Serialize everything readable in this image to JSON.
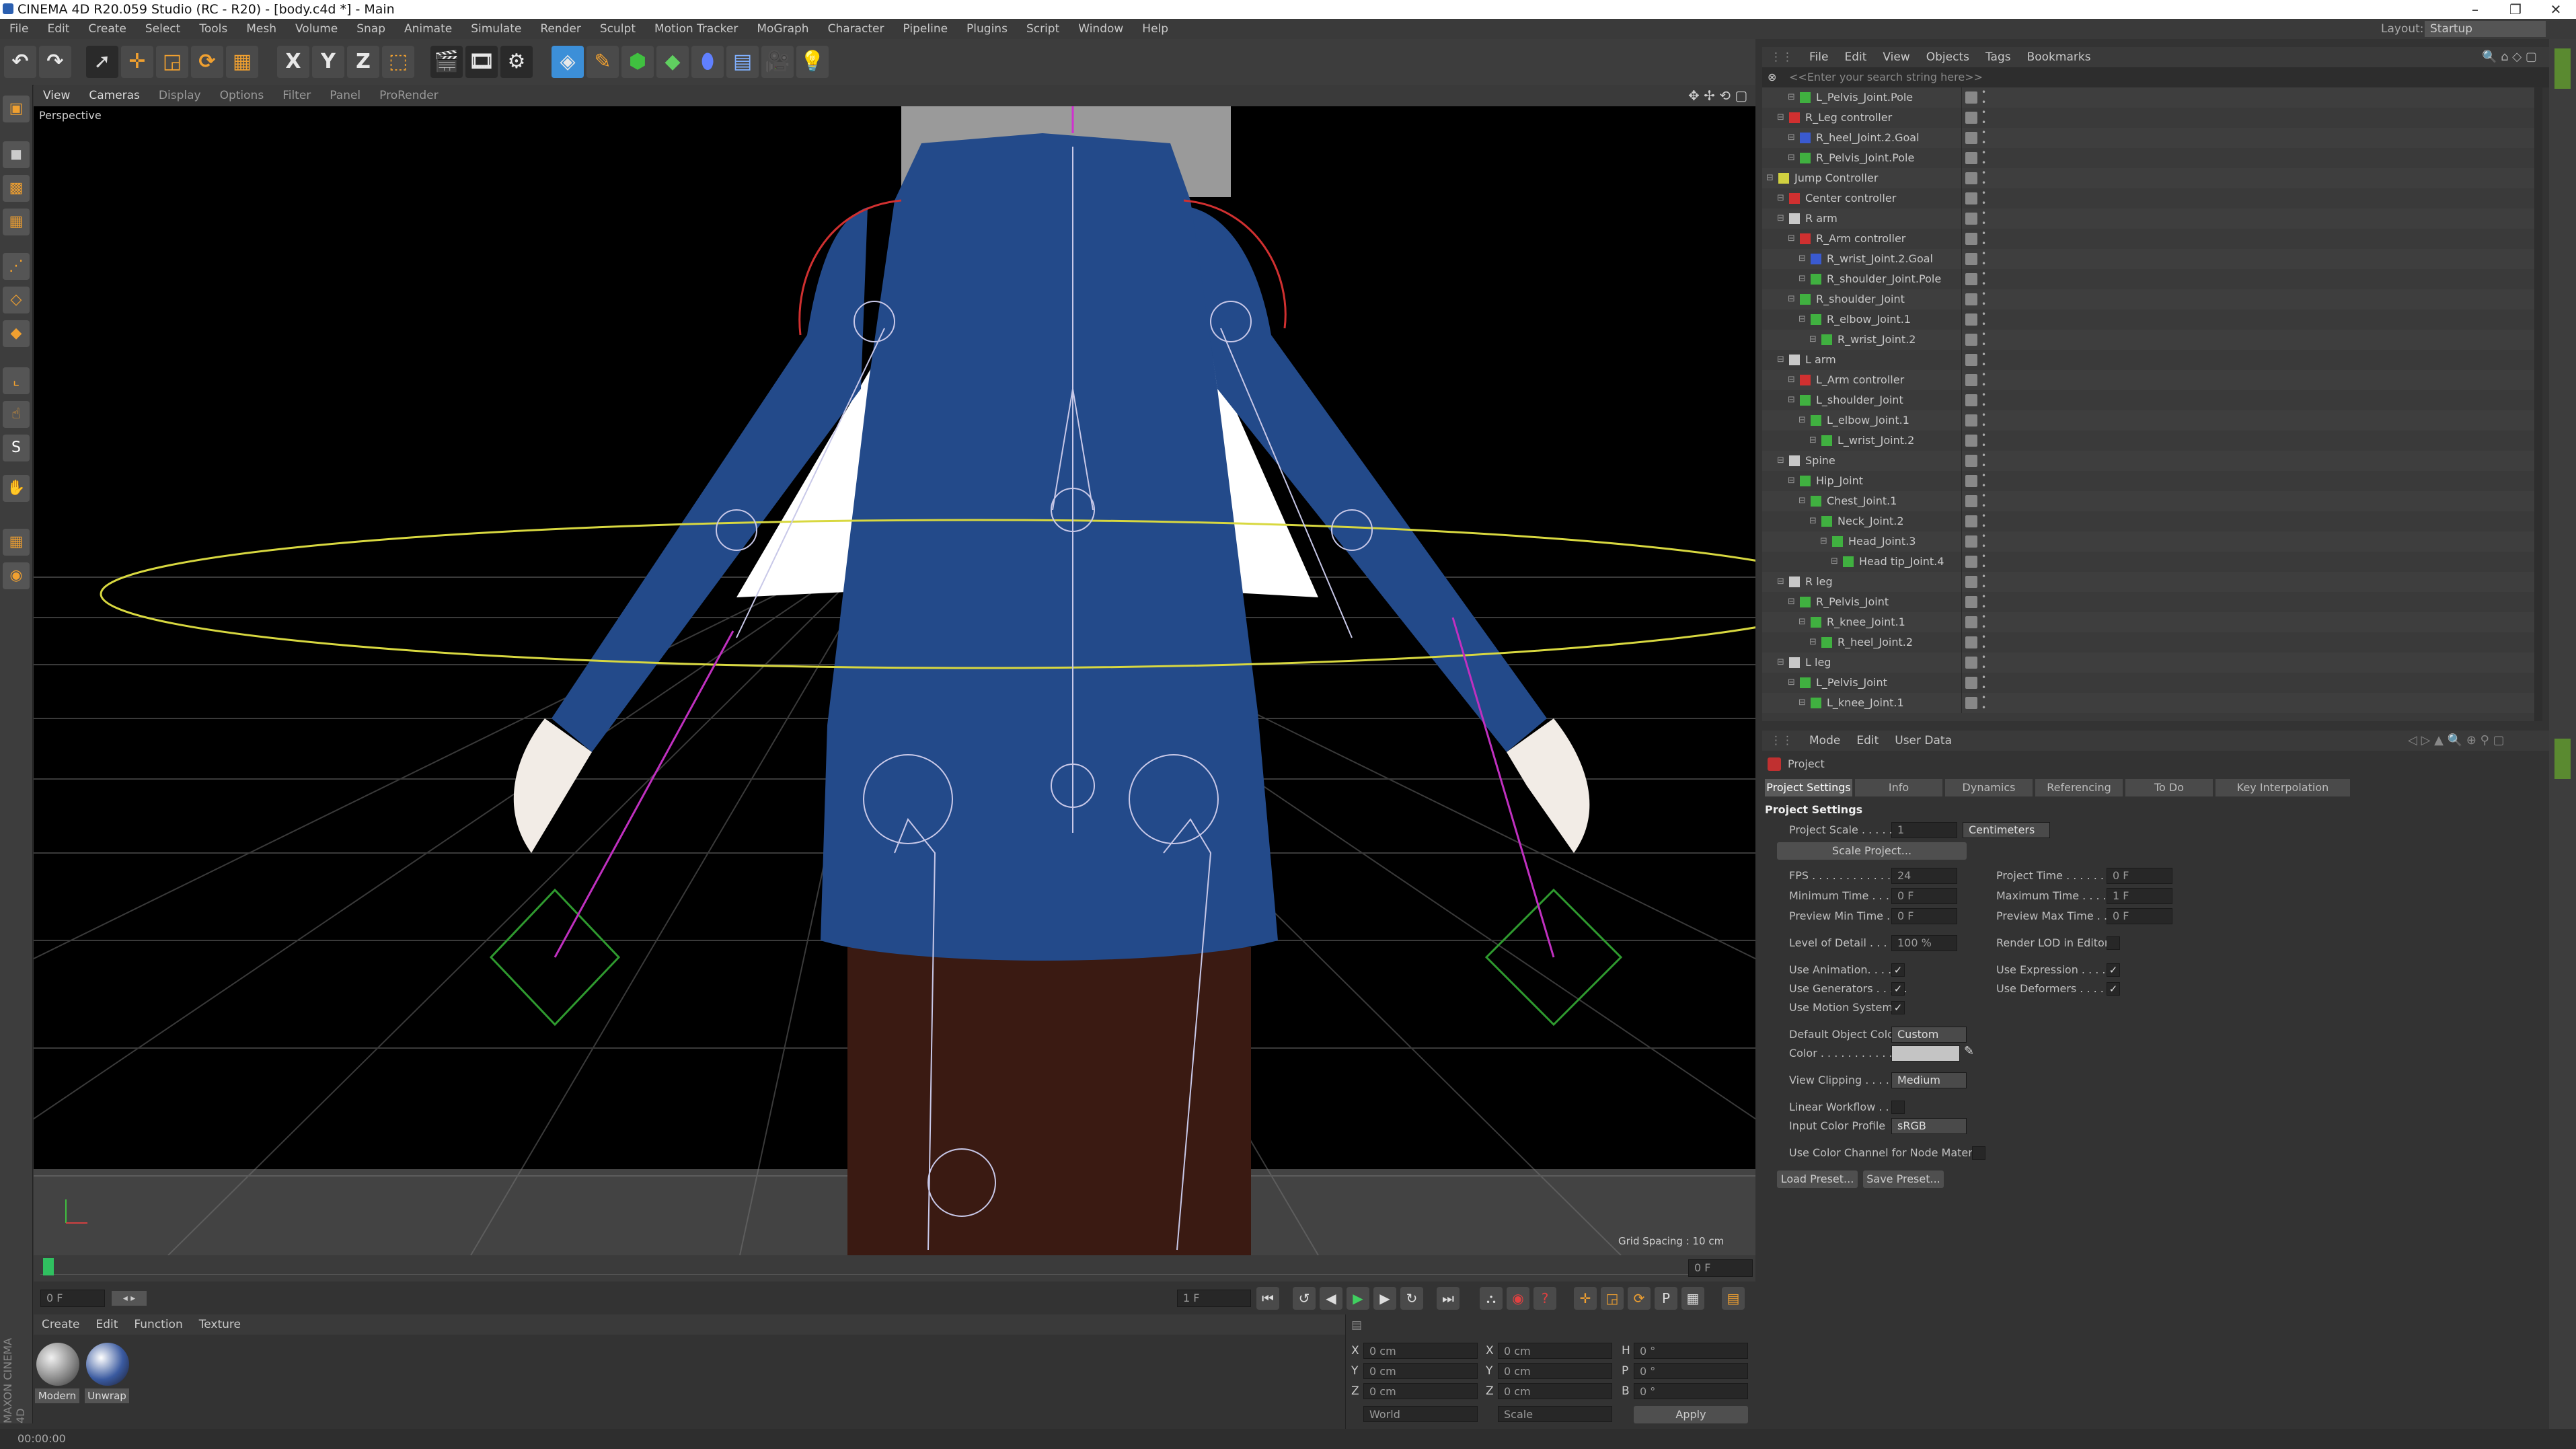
{
  "window": {
    "title": "CINEMA 4D R20.059 Studio (RC - R20) - [body.c4d *] - Main",
    "layout_label": "Layout:",
    "layout_value": "Startup"
  },
  "menu": [
    "File",
    "Edit",
    "Create",
    "Select",
    "Tools",
    "Mesh",
    "Volume",
    "Snap",
    "Animate",
    "Simulate",
    "Render",
    "Sculpt",
    "Motion Tracker",
    "MoGraph",
    "Character",
    "Pipeline",
    "Plugins",
    "Script",
    "Window",
    "Help"
  ],
  "toolbar": {
    "x": "X",
    "y": "Y",
    "z": "Z"
  },
  "viewport": {
    "menu": [
      "View",
      "Cameras",
      "Display",
      "Options",
      "Filter",
      "Panel",
      "ProRender"
    ],
    "camera": "Perspective",
    "grid_spacing": "Grid Spacing : 10 cm"
  },
  "timeline": {
    "current_frame": "0 F",
    "end_frame": "0 F",
    "range_start": "0 F",
    "range_end": "1 F"
  },
  "materials": {
    "menu": [
      "Create",
      "Edit",
      "Function",
      "Texture"
    ],
    "items": [
      {
        "name": "Modern",
        "color": "#bdbdbd"
      },
      {
        "name": "Unwrap",
        "color": "#d8d8d8"
      }
    ]
  },
  "coords": {
    "rows": [
      {
        "a": "X",
        "av": "0 cm",
        "b": "X",
        "bv": "0 cm",
        "c": "H",
        "cv": "0 °"
      },
      {
        "a": "Y",
        "av": "0 cm",
        "b": "Y",
        "bv": "0 cm",
        "c": "P",
        "cv": "0 °"
      },
      {
        "a": "Z",
        "av": "0 cm",
        "b": "Z",
        "bv": "0 cm",
        "c": "B",
        "cv": "0 °"
      }
    ],
    "mode": "World",
    "scale": "Scale",
    "apply": "Apply"
  },
  "status": {
    "time": "00:00:00"
  },
  "objects": {
    "menu": [
      "File",
      "Edit",
      "View",
      "Objects",
      "Tags",
      "Bookmarks"
    ],
    "search_placeholder": "<<Enter your search string here>>",
    "rows": [
      {
        "name": "L_Pelvis_Joint.Pole",
        "indent": 2,
        "icon": "#40b040"
      },
      {
        "name": "R_Leg controller",
        "indent": 1,
        "icon": "#d03030"
      },
      {
        "name": "R_heel_Joint.2.Goal",
        "indent": 2,
        "icon": "#3a5ad0"
      },
      {
        "name": "R_Pelvis_Joint.Pole",
        "indent": 2,
        "icon": "#40b040"
      },
      {
        "name": "Jump Controller",
        "indent": 0,
        "icon": "#d0d040"
      },
      {
        "name": "Center controller",
        "indent": 1,
        "icon": "#d03030"
      },
      {
        "name": "R arm",
        "indent": 1,
        "icon": "#c8c8c8"
      },
      {
        "name": "R_Arm controller",
        "indent": 2,
        "icon": "#d03030"
      },
      {
        "name": "R_wrist_Joint.2.Goal",
        "indent": 3,
        "icon": "#3a5ad0"
      },
      {
        "name": "R_shoulder_Joint.Pole",
        "indent": 3,
        "icon": "#40b040"
      },
      {
        "name": "R_shoulder_Joint",
        "indent": 2,
        "icon": "#40b040"
      },
      {
        "name": "R_elbow_Joint.1",
        "indent": 3,
        "icon": "#40b040"
      },
      {
        "name": "R_wrist_Joint.2",
        "indent": 4,
        "icon": "#40b040"
      },
      {
        "name": "L arm",
        "indent": 1,
        "icon": "#c8c8c8"
      },
      {
        "name": "L_Arm controller",
        "indent": 2,
        "icon": "#d03030"
      },
      {
        "name": "L_shoulder_Joint",
        "indent": 2,
        "icon": "#40b040"
      },
      {
        "name": "L_elbow_Joint.1",
        "indent": 3,
        "icon": "#40b040"
      },
      {
        "name": "L_wrist_Joint.2",
        "indent": 4,
        "icon": "#40b040"
      },
      {
        "name": "Spine",
        "indent": 1,
        "icon": "#c8c8c8"
      },
      {
        "name": "Hip_Joint",
        "indent": 2,
        "icon": "#40b040"
      },
      {
        "name": "Chest_Joint.1",
        "indent": 3,
        "icon": "#40b040"
      },
      {
        "name": "Neck_Joint.2",
        "indent": 4,
        "icon": "#40b040"
      },
      {
        "name": "Head_Joint.3",
        "indent": 5,
        "icon": "#40b040"
      },
      {
        "name": "Head tip_Joint.4",
        "indent": 6,
        "icon": "#40b040"
      },
      {
        "name": "R leg",
        "indent": 1,
        "icon": "#c8c8c8"
      },
      {
        "name": "R_Pelvis_Joint",
        "indent": 2,
        "icon": "#40b040"
      },
      {
        "name": "R_knee_Joint.1",
        "indent": 3,
        "icon": "#40b040"
      },
      {
        "name": "R_heel_Joint.2",
        "indent": 4,
        "icon": "#40b040"
      },
      {
        "name": "L leg",
        "indent": 1,
        "icon": "#c8c8c8"
      },
      {
        "name": "L_Pelvis_Joint",
        "indent": 2,
        "icon": "#40b040"
      },
      {
        "name": "L_knee_Joint.1",
        "indent": 3,
        "icon": "#40b040"
      }
    ]
  },
  "attributes": {
    "menu": [
      "Mode",
      "Edit",
      "User Data"
    ],
    "header": "Project",
    "tabs": [
      "Project Settings",
      "Info",
      "Dynamics",
      "Referencing",
      "To Do",
      "Key Interpolation"
    ],
    "section": "Project Settings",
    "project_scale_label": "Project Scale . . . . . .",
    "project_scale_value": "1",
    "project_scale_unit": "Centimeters",
    "scale_project": "Scale Project...",
    "fps_label": "FPS . . . . . . . . . . . .",
    "fps": "24",
    "project_time_label": "Project Time . . . . . . .",
    "project_time": "0 F",
    "min_time_label": "Minimum Time . . . . .",
    "min_time": "0 F",
    "max_time_label": "Maximum Time . . . . .",
    "max_time": "1 F",
    "pv_min_label": "Preview Min Time . . .",
    "pv_min": "0 F",
    "pv_max_label": "Preview Max Time . . .",
    "pv_max": "0 F",
    "lod_label": "Level of Detail . . . . .",
    "lod": "100 %",
    "render_lod_label": "Render LOD in Editor",
    "use_anim": "Use Animation. . . . . .",
    "use_expr": "Use Expression . . . . .",
    "use_gen": "Use Generators . . . . .",
    "use_def": "Use Deformers . . . . .",
    "use_motion": "Use Motion System",
    "def_color_label": "Default Object Color",
    "def_color": "Custom",
    "color_label": "Color . . . . . . . . . . .",
    "view_clip_label": "View Clipping . . . . . .",
    "view_clip": "Medium",
    "linear_label": "Linear Workflow . . .",
    "input_profile_label": "Input Color Profile",
    "input_profile": "sRGB",
    "node_mat_label": "Use Color Channel for Node Material",
    "load_preset": "Load Preset...",
    "save_preset": "Save Preset..."
  }
}
